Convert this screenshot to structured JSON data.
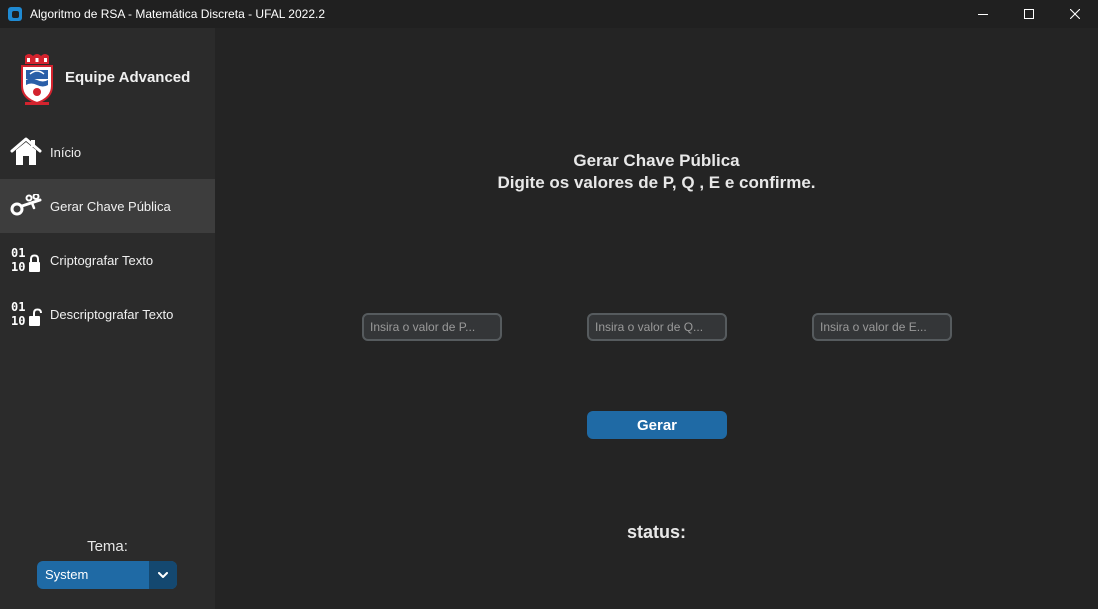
{
  "window": {
    "title": "Algoritmo de RSA - Matemática Discreta -  UFAL 2022.2"
  },
  "sidebar": {
    "brand_name": "Equipe Advanced",
    "items": [
      {
        "label": "Início",
        "icon": "home-icon"
      },
      {
        "label": "Gerar Chave Pública",
        "icon": "key-icon",
        "active": true
      },
      {
        "label": "Criptografar Texto",
        "icon": "binary-lock-icon"
      },
      {
        "label": "Descriptografar Texto",
        "icon": "binary-unlock-icon"
      }
    ],
    "theme_label": "Tema:",
    "theme_value": "System"
  },
  "main": {
    "heading_line1": "Gerar Chave Pública",
    "heading_line2": "Digite os valores de P, Q , E e confirme.",
    "p_placeholder": "Insira o valor de P...",
    "q_placeholder": "Insira o valor de Q...",
    "e_placeholder": "Insira o valor de E...",
    "p_value": "",
    "q_value": "",
    "e_value": "",
    "generate_label": "Gerar",
    "status_label": "status:"
  },
  "colors": {
    "accent": "#1f6aa5",
    "sidebar_bg": "#2b2b2b",
    "main_bg": "#242424",
    "active_item": "#3d3d3d"
  }
}
